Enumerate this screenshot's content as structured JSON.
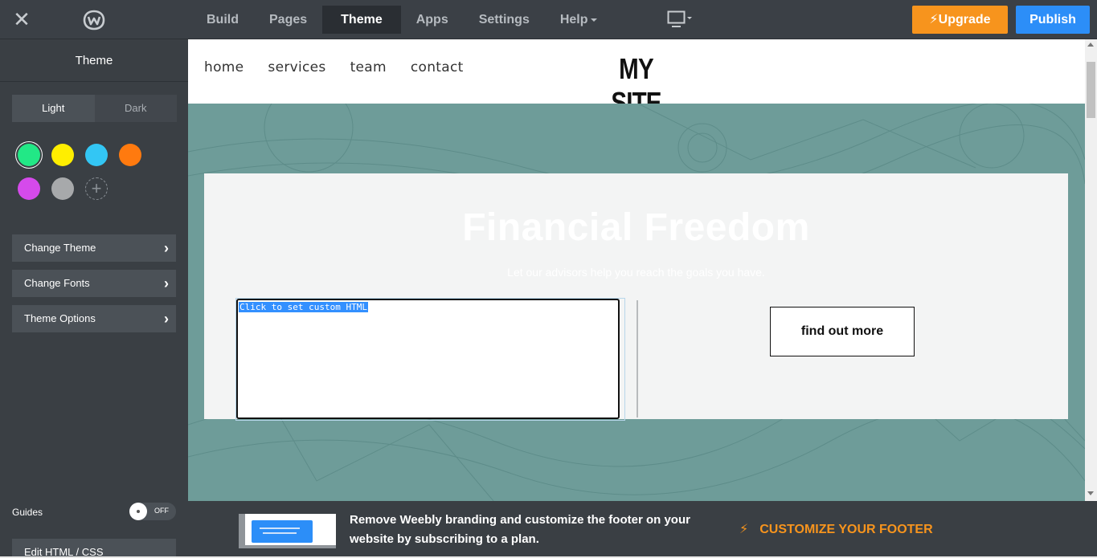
{
  "topbar": {
    "nav": [
      "Build",
      "Pages",
      "Theme",
      "Apps",
      "Settings",
      "Help"
    ],
    "active": "Theme",
    "upgrade_label": "Upgrade",
    "publish_label": "Publish"
  },
  "sidebar": {
    "title": "Theme",
    "light_label": "Light",
    "dark_label": "Dark",
    "swatch_colors": [
      "#22e886",
      "#ffee00",
      "#33c6f4",
      "#ff7a0f",
      "#d54aeb",
      "#a7a9ab"
    ],
    "selected_swatch": "#22e886",
    "buttons": [
      "Change Theme",
      "Change Fonts",
      "Theme Options"
    ],
    "guides_label": "Guides",
    "guides_state": "OFF",
    "edit_html_label": "Edit HTML / CSS"
  },
  "site": {
    "nav": [
      "home",
      "services",
      "team",
      "contact"
    ],
    "title": "MY SITE",
    "hero_title": "Financial Freedom",
    "hero_subtitle": "Let our advisors help you reach the goals you have.",
    "custom_html_placeholder": "Click to set custom HTML",
    "cta_label": "find out more"
  },
  "footer_banner": {
    "text": "Remove Weebly branding and customize the footer on your website by subscribing to a plan.",
    "cta": "CUSTOMIZE YOUR FOOTER"
  }
}
